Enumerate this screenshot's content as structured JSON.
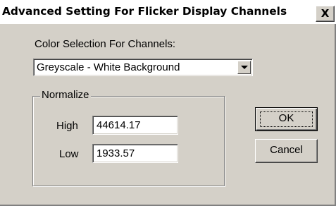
{
  "window": {
    "title": "Advanced Setting For Flicker Display Channels",
    "close_glyph": "X"
  },
  "color_selection": {
    "label": "Color Selection For Channels:",
    "selected": "Greyscale - White Background"
  },
  "normalize": {
    "group_label": "Normalize",
    "high_label": "High",
    "high_value": "44614.17",
    "low_label": "Low",
    "low_value": "1933.57"
  },
  "buttons": {
    "ok": "OK",
    "cancel": "Cancel"
  }
}
